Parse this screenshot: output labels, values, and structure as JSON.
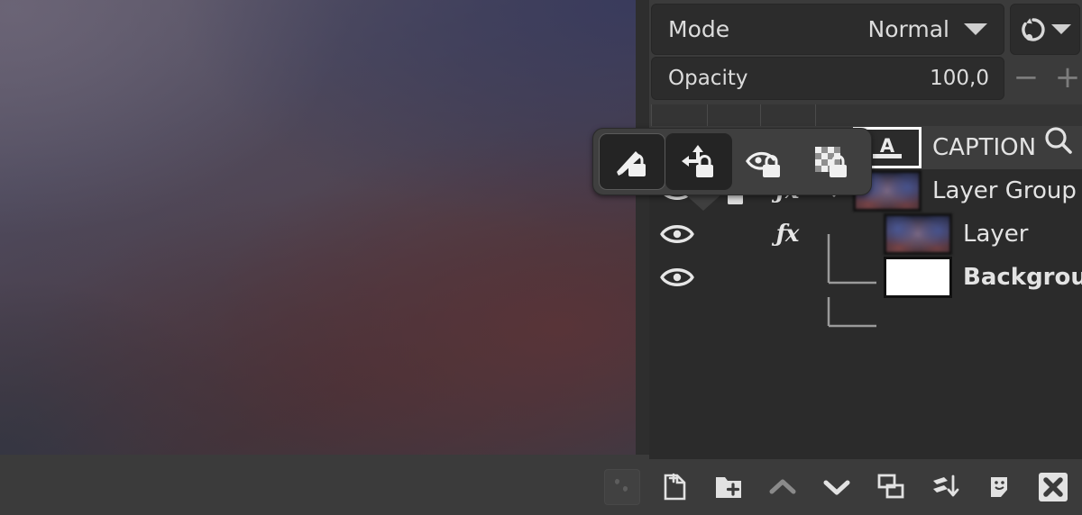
{
  "panel": {
    "mode": {
      "label": "Mode",
      "value": "Normal",
      "reset_icon": "mode-group-switch-icon",
      "dropdown_icon": "chevron-down-icon"
    },
    "opacity": {
      "label": "Opacity",
      "value": "100,0",
      "minus": "−",
      "plus": "+"
    },
    "search_icon": "search-icon"
  },
  "lock_popup": {
    "buttons": [
      {
        "name": "lock-pixels",
        "icon": "brush-lock-icon",
        "active": true
      },
      {
        "name": "lock-position",
        "icon": "move-lock-icon",
        "active": true
      },
      {
        "name": "lock-visibility",
        "icon": "eye-lock-icon",
        "active": false
      },
      {
        "name": "lock-alpha",
        "icon": "checkerboard-lock-icon",
        "active": false
      }
    ]
  },
  "layers": [
    {
      "name": "CAPTION",
      "visible": true,
      "locked": false,
      "fx": true,
      "kind": "text",
      "selected": true,
      "indent": 0,
      "bold": false,
      "expander": false
    },
    {
      "name": "Layer Group",
      "visible": true,
      "locked": true,
      "fx": true,
      "kind": "image",
      "selected": false,
      "indent": 0,
      "bold": false,
      "expander": true
    },
    {
      "name": "Layer",
      "visible": true,
      "locked": false,
      "fx": true,
      "kind": "image",
      "selected": false,
      "indent": 1,
      "bold": false,
      "expander": false
    },
    {
      "name": "Background",
      "visible": true,
      "locked": false,
      "fx": false,
      "kind": "white",
      "selected": false,
      "indent": 1,
      "bold": true,
      "expander": false
    }
  ],
  "bottom_toolbar": [
    {
      "name": "anchor-floating-layer-button",
      "icon": "anchor-icon",
      "disabled": true
    },
    {
      "name": "new-layer-button",
      "icon": "new-layer-icon",
      "disabled": false
    },
    {
      "name": "new-layer-group-button",
      "icon": "new-layer-group-icon",
      "disabled": false
    },
    {
      "name": "raise-layer-button",
      "icon": "chevron-up-icon",
      "disabled": false
    },
    {
      "name": "lower-layer-button",
      "icon": "chevron-down-icon",
      "disabled": false
    },
    {
      "name": "duplicate-layer-button",
      "icon": "duplicate-icon",
      "disabled": false
    },
    {
      "name": "merge-down-button",
      "icon": "merge-down-icon",
      "disabled": false
    },
    {
      "name": "add-layer-mask-button",
      "icon": "layer-mask-icon",
      "disabled": false
    },
    {
      "name": "delete-layer-button",
      "icon": "delete-x-icon",
      "disabled": false
    }
  ],
  "colors": {
    "panel_bg": "#3b3b3b",
    "list_bg": "#2b2b2b",
    "row_selected": "#3d3d3d",
    "field_bg": "#2c2c2c",
    "text": "#dcdcdc",
    "popup_bg": "#3f3f3f"
  }
}
